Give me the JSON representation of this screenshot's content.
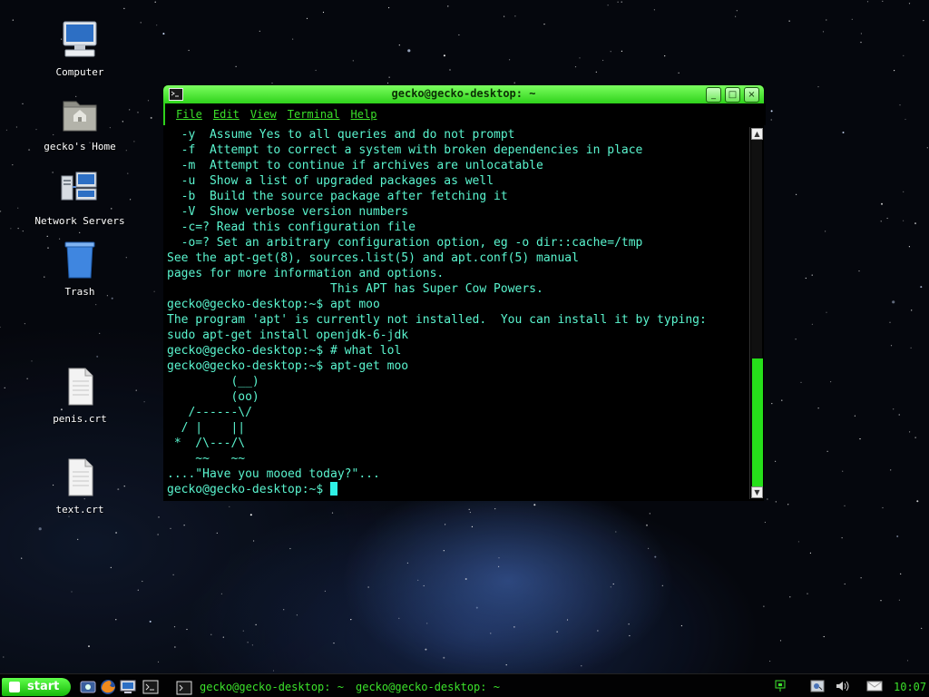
{
  "desktop": {
    "icons": [
      {
        "label": "Computer",
        "icon": "computer-icon"
      },
      {
        "label": "gecko's Home",
        "icon": "home-folder-icon"
      },
      {
        "label": "Network Servers",
        "icon": "network-servers-icon"
      },
      {
        "label": "Trash",
        "icon": "trash-icon"
      },
      {
        "label": "penis.crt",
        "icon": "document-icon"
      },
      {
        "label": "text.crt",
        "icon": "document-icon"
      }
    ]
  },
  "window": {
    "title": "gecko@gecko-desktop: ~",
    "buttons": {
      "minimize": "_",
      "maximize": "□",
      "close": "×"
    },
    "menu": [
      "File",
      "Edit",
      "View",
      "Terminal",
      "Help"
    ]
  },
  "terminal": {
    "lines": [
      "  -y  Assume Yes to all queries and do not prompt",
      "  -f  Attempt to correct a system with broken dependencies in place",
      "  -m  Attempt to continue if archives are unlocatable",
      "  -u  Show a list of upgraded packages as well",
      "  -b  Build the source package after fetching it",
      "  -V  Show verbose version numbers",
      "  -c=? Read this configuration file",
      "  -o=? Set an arbitrary configuration option, eg -o dir::cache=/tmp",
      "See the apt-get(8), sources.list(5) and apt.conf(5) manual",
      "pages for more information and options.",
      "                       This APT has Super Cow Powers.",
      "gecko@gecko-desktop:~$ apt moo",
      "The program 'apt' is currently not installed.  You can install it by typing:",
      "sudo apt-get install openjdk-6-jdk",
      "gecko@gecko-desktop:~$ # what lol",
      "gecko@gecko-desktop:~$ apt-get moo",
      "         (__)",
      "         (oo)",
      "   /------\\/",
      "  / |    ||",
      " *  /\\---/\\",
      "    ~~   ~~",
      "....\"Have you mooed today?\"..."
    ],
    "prompt": "gecko@gecko-desktop:~$ ",
    "scroll_position": 0.62,
    "colors": {
      "text": "#5af5cf",
      "accent": "#2fd21b",
      "background": "#000000"
    }
  },
  "taskbar": {
    "start_label": "start",
    "launchers": [
      "network-monitor-icon",
      "firefox-icon",
      "show-desktop-icon",
      "terminal-icon"
    ],
    "tasks": [
      {
        "label": "gecko@gecko-desktop: ~",
        "icon": "terminal-icon"
      },
      {
        "label": "gecko@gecko-desktop: ~"
      }
    ],
    "tray": [
      "network-status-icon",
      "update-icon",
      "volume-icon",
      "mail-icon"
    ],
    "clock": "10:07"
  }
}
